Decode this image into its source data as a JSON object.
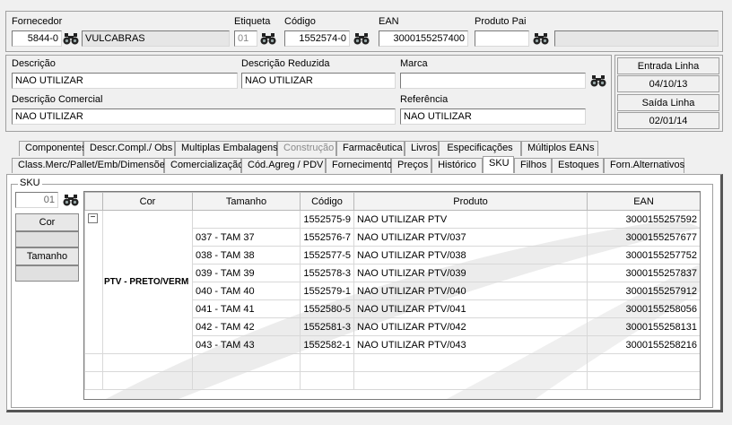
{
  "header": {
    "fornecedor_label": "Fornecedor",
    "fornecedor_code": "5844-0",
    "fornecedor_name": "VULCABRAS",
    "etiqueta_label": "Etiqueta",
    "etiqueta_value": "01",
    "codigo_label": "Código",
    "codigo_value": "1552574-0",
    "ean_label": "EAN",
    "ean_value": "3000155257400",
    "produto_pai_label": "Produto Pai",
    "produto_pai_value": "",
    "produto_pai_desc": ""
  },
  "desc": {
    "descricao_label": "Descrição",
    "descricao_value": "NAO UTILIZAR",
    "desc_reduzida_label": "Descrição Reduzida",
    "desc_reduzida_value": "NAO UTILIZAR",
    "marca_label": "Marca",
    "marca_value": "",
    "desc_comercial_label": "Descrição Comercial",
    "desc_comercial_value": "NAO UTILIZAR",
    "referencia_label": "Referência",
    "referencia_value": "NAO UTILIZAR"
  },
  "linha": {
    "entrada_label": "Entrada Linha",
    "entrada_value": "04/10/13",
    "saida_label": "Saída Linha",
    "saida_value": "02/01/14"
  },
  "tabs_row1": [
    {
      "label": "Componentes",
      "disabled": false
    },
    {
      "label": "Descr.Compl./ Obs",
      "disabled": false
    },
    {
      "label": "Multiplas Embalagens",
      "disabled": false
    },
    {
      "label": "Construção",
      "disabled": true
    },
    {
      "label": "Farmacêutica",
      "disabled": false
    },
    {
      "label": "Livros",
      "disabled": false
    },
    {
      "label": "Especificações",
      "disabled": false
    },
    {
      "label": "Múltiplos EANs",
      "disabled": false
    }
  ],
  "tabs_row2": [
    {
      "label": "Class.Merc/Pallet/Emb/Dimensões"
    },
    {
      "label": "Comercialização"
    },
    {
      "label": "Cód.Agreg / PDV"
    },
    {
      "label": "Fornecimento"
    },
    {
      "label": "Preços"
    },
    {
      "label": "Histórico"
    },
    {
      "label": "SKU"
    },
    {
      "label": "Filhos"
    },
    {
      "label": "Estoques"
    },
    {
      "label": "Forn.Alternativos"
    }
  ],
  "sku": {
    "group_label": "SKU",
    "sku_input": "01",
    "cor_button": "Cor",
    "tamanho_button": "Tamanho",
    "columns": [
      "Cor",
      "Tamanho",
      "Código",
      "Produto",
      "EAN"
    ],
    "collapse_symbol": "−",
    "cor_group_value": "PTV - PRETO/VERM",
    "rows": [
      {
        "tamanho": "",
        "codigo": "1552575-9",
        "produto": "NAO UTILIZAR PTV",
        "ean": "3000155257592"
      },
      {
        "tamanho": "037  - TAM 37",
        "codigo": "1552576-7",
        "produto": "NAO UTILIZAR PTV/037",
        "ean": "3000155257677"
      },
      {
        "tamanho": "038  - TAM 38",
        "codigo": "1552577-5",
        "produto": "NAO UTILIZAR PTV/038",
        "ean": "3000155257752"
      },
      {
        "tamanho": "039  - TAM 39",
        "codigo": "1552578-3",
        "produto": "NAO UTILIZAR PTV/039",
        "ean": "3000155257837"
      },
      {
        "tamanho": "040  - TAM 40",
        "codigo": "1552579-1",
        "produto": "NAO UTILIZAR PTV/040",
        "ean": "3000155257912"
      },
      {
        "tamanho": "041  - TAM 41",
        "codigo": "1552580-5",
        "produto": "NAO UTILIZAR PTV/041",
        "ean": "3000155258056"
      },
      {
        "tamanho": "042  - TAM 42",
        "codigo": "1552581-3",
        "produto": "NAO UTILIZAR PTV/042",
        "ean": "3000155258131"
      },
      {
        "tamanho": "043  - TAM 43",
        "codigo": "1552582-1",
        "produto": "NAO UTILIZAR PTV/043",
        "ean": "3000155258216"
      }
    ]
  },
  "icons": {
    "binoculars": "binoculars-icon"
  }
}
